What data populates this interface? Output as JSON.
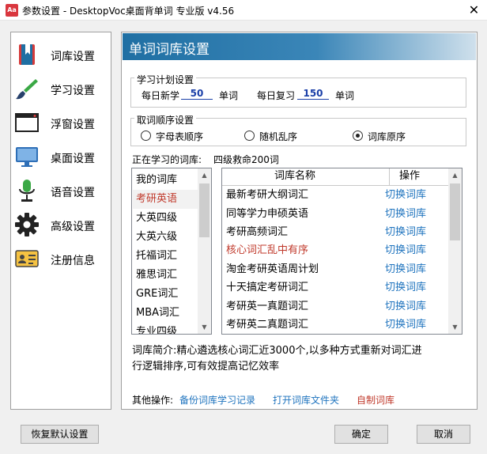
{
  "window": {
    "title": "参数设置 - DesktopVoc桌面背单词 专业版 v4.56",
    "icon_text": "Aa"
  },
  "sidebar": {
    "items": [
      {
        "label": "词库设置",
        "icon": "bookmark-book-icon"
      },
      {
        "label": "学习设置",
        "icon": "brush-icon"
      },
      {
        "label": "浮窗设置",
        "icon": "window-icon"
      },
      {
        "label": "桌面设置",
        "icon": "monitor-icon"
      },
      {
        "label": "语音设置",
        "icon": "microphone-icon"
      },
      {
        "label": "高级设置",
        "icon": "gear-icon"
      },
      {
        "label": "注册信息",
        "icon": "id-card-icon"
      }
    ]
  },
  "main": {
    "banner_title": "单词词库设置",
    "plan": {
      "legend": "学习计划设置",
      "new_label": "每日新学",
      "new_value": "50",
      "new_unit": "单词",
      "review_label": "每日复习",
      "review_value": "150",
      "review_unit": "单词"
    },
    "order": {
      "legend": "取词顺序设置",
      "options": [
        {
          "label": "字母表顺序",
          "checked": false
        },
        {
          "label": "随机乱序",
          "checked": false
        },
        {
          "label": "词库原序",
          "checked": true
        }
      ]
    },
    "current_label": "正在学习的词库:",
    "current_value": "四级救命200词",
    "categories": [
      "我的词库",
      "考研英语",
      "大英四级",
      "大英六级",
      "托福词汇",
      "雅思词汇",
      "GRE词汇",
      "MBA词汇",
      "专业四级"
    ],
    "selected_category": "考研英语",
    "grid": {
      "col_name": "词库名称",
      "col_action": "操作",
      "rows": [
        {
          "name": "最新考研大纲词汇",
          "action": "切换词库",
          "highlight": false
        },
        {
          "name": "同等学力申硕英语",
          "action": "切换词库",
          "highlight": false
        },
        {
          "name": "考研高频词汇",
          "action": "切换词库",
          "highlight": false
        },
        {
          "name": "核心词汇乱中有序",
          "action": "切换词库",
          "highlight": true
        },
        {
          "name": "淘金考研英语周计划",
          "action": "切换词库",
          "highlight": false
        },
        {
          "name": "十天搞定考研词汇",
          "action": "切换词库",
          "highlight": false
        },
        {
          "name": "考研英一真题词汇",
          "action": "切换词库",
          "highlight": false
        },
        {
          "name": "考研英二真题词汇",
          "action": "切换词库",
          "highlight": false
        }
      ]
    },
    "intro_line1": "词库简介:精心遴选核心词汇近3000个,以多种方式重新对词汇进",
    "intro_line2": "行逻辑排序,可有效提高记忆效率",
    "other_label": "其他操作:",
    "other_links": [
      "备份词库学习记录",
      "打开词库文件夹",
      "自制词库"
    ]
  },
  "footer": {
    "reset": "恢复默认设置",
    "ok": "确定",
    "cancel": "取消"
  }
}
